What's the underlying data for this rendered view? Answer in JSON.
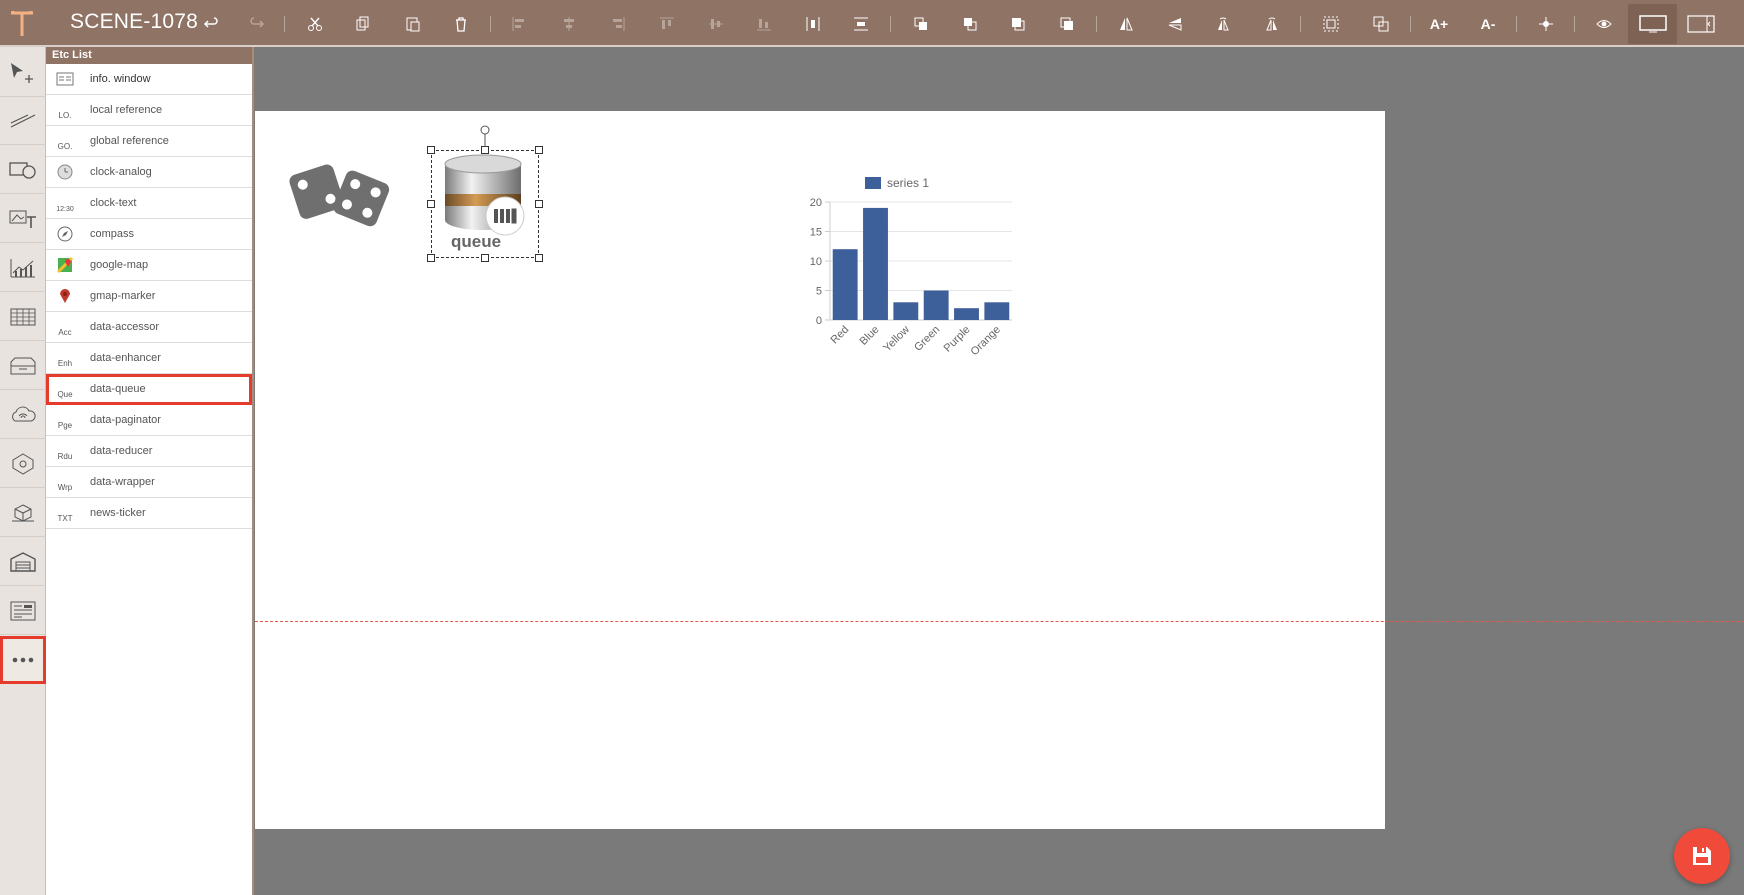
{
  "app": {
    "scene_title": "SCENE-1078"
  },
  "toolbar": {
    "buttons": [
      "undo",
      "redo",
      "cut",
      "copy",
      "paste",
      "delete",
      "align-left",
      "align-center",
      "align-right",
      "align-top",
      "align-middle",
      "align-bottom",
      "distribute-horizontal",
      "distribute-vertical",
      "bring-forward",
      "send-backward",
      "bring-to-front",
      "send-to-back",
      "flip-horizontal",
      "flip-vertical",
      "rotate-left",
      "rotate-right",
      "group",
      "ungroup",
      "font-increase",
      "font-decrease",
      "fit",
      "preview",
      "display-mode",
      "sidebar-toggle"
    ],
    "font_increase_label": "A+",
    "font_decrease_label": "A-"
  },
  "panel": {
    "title": "Etc List",
    "items": [
      {
        "label": "info. window",
        "icon": "info-window-icon",
        "icon_text": ""
      },
      {
        "label": "local reference",
        "icon": "local-reference-icon",
        "icon_text": "LO."
      },
      {
        "label": "global reference",
        "icon": "global-reference-icon",
        "icon_text": "GO."
      },
      {
        "label": "clock-analog",
        "icon": "clock-analog-icon",
        "icon_text": ""
      },
      {
        "label": "clock-text",
        "icon": "clock-text-icon",
        "icon_text": "12:30"
      },
      {
        "label": "compass",
        "icon": "compass-icon",
        "icon_text": ""
      },
      {
        "label": "google-map",
        "icon": "google-map-icon",
        "icon_text": ""
      },
      {
        "label": "gmap-marker",
        "icon": "gmap-marker-icon",
        "icon_text": ""
      },
      {
        "label": "data-accessor",
        "icon": "data-accessor-icon",
        "icon_text": "Acc"
      },
      {
        "label": "data-enhancer",
        "icon": "data-enhancer-icon",
        "icon_text": "Enh"
      },
      {
        "label": "data-queue",
        "icon": "data-queue-icon",
        "icon_text": "Que"
      },
      {
        "label": "data-paginator",
        "icon": "data-paginator-icon",
        "icon_text": "Pge"
      },
      {
        "label": "data-reducer",
        "icon": "data-reducer-icon",
        "icon_text": "Rdu"
      },
      {
        "label": "data-wrapper",
        "icon": "data-wrapper-icon",
        "icon_text": "Wrp"
      },
      {
        "label": "news-ticker",
        "icon": "news-ticker-icon",
        "icon_text": "TXT"
      }
    ],
    "selected": "data-queue"
  },
  "canvas": {
    "queue_label": "queue"
  },
  "chart_data": {
    "type": "bar",
    "categories": [
      "Red",
      "Blue",
      "Yellow",
      "Green",
      "Purple",
      "Orange"
    ],
    "series": [
      {
        "name": "series 1",
        "values": [
          12,
          19,
          3,
          5,
          2,
          3
        ]
      }
    ],
    "ylim": [
      0,
      20
    ],
    "yticks": [
      0,
      5,
      10,
      15,
      20
    ],
    "legend": "top",
    "color": "#3d5f9a"
  },
  "colors": {
    "toolbar": "#8f7365",
    "accent": "#e53b2c",
    "save": "#f04a3b"
  }
}
